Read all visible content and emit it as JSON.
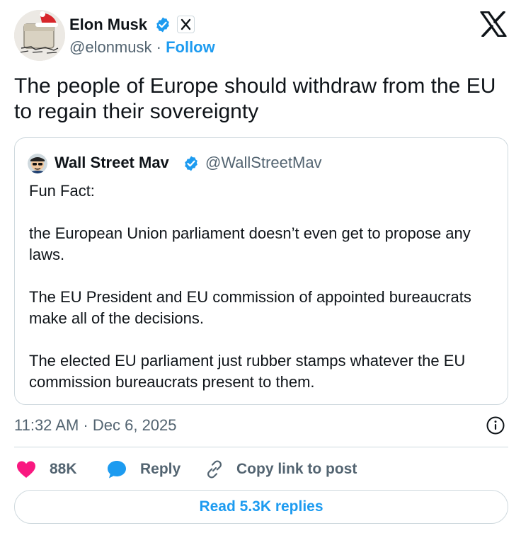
{
  "author": {
    "name": "Elon Musk",
    "handle": "@elonmusk",
    "separator": "·",
    "follow_label": "Follow",
    "avatar_icon": "santa-hat-avatar",
    "verified_color": "#1d9bf0"
  },
  "tweet": {
    "text": "The people of Europe should withdraw from the EU to regain their sovereignty"
  },
  "quote": {
    "author_name": "Wall Street Mav",
    "handle": "@WallStreetMav",
    "paragraphs": [
      "Fun Fact:",
      "the European Union parliament doesn’t even get to propose any laws.",
      "The EU President and EU commission of appointed bureaucrats make all of the decisions.",
      "The elected EU parliament just rubber stamps whatever the EU commission bureaucrats present to them."
    ]
  },
  "meta": {
    "timestamp": "11:32 AM · Dec 6, 2025"
  },
  "actions": {
    "likes": "88K",
    "reply_label": "Reply",
    "copy_label": "Copy link to post",
    "like_color": "#f91880",
    "accent_color": "#1d9bf0"
  },
  "footer": {
    "read_replies": "Read 5.3K replies"
  }
}
